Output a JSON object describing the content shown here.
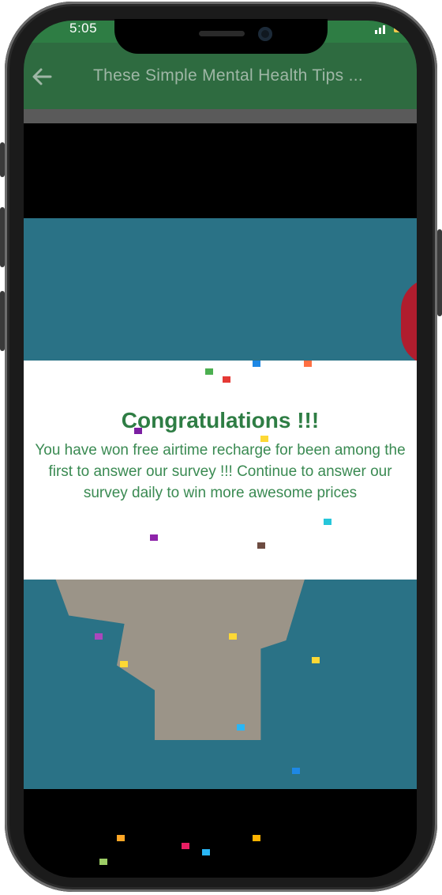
{
  "status_bar": {
    "time": "5:05"
  },
  "app_bar": {
    "title": "These Simple Mental Health Tips ..."
  },
  "dialog": {
    "title": "Congratulations !!!",
    "message": "You have won free airtime recharge for been among the first to answer our survey !!! Continue to answer our survey daily to win more awesome prices"
  },
  "colors": {
    "accent": "#2e7d44",
    "app_bar": "#2e6b40",
    "video_bg": "#2a7286"
  },
  "icons": [
    "back-arrow-icon",
    "signal-icon",
    "battery-icon"
  ]
}
